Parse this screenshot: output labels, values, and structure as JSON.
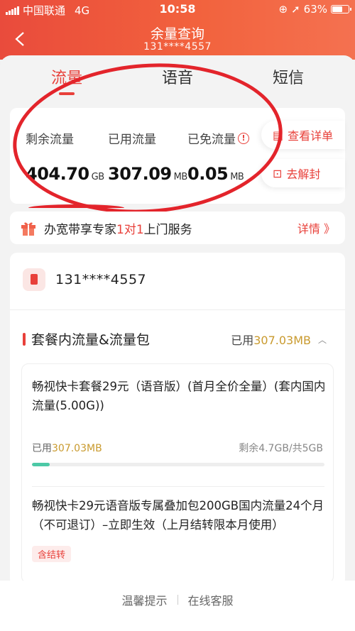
{
  "status_bar": {
    "carrier": "中国联通",
    "network": "4G",
    "time": "10:58",
    "battery_percent": "63%"
  },
  "header": {
    "title": "余量查询",
    "phone": "131****4557"
  },
  "tabs": [
    {
      "label": "流量",
      "active": true
    },
    {
      "label": "语音",
      "active": false
    },
    {
      "label": "短信",
      "active": false
    }
  ],
  "usage": {
    "remaining": {
      "label": "剩余流量",
      "value": "404.70",
      "unit": "GB"
    },
    "used": {
      "label": "已用流量",
      "value": "307.09",
      "unit": "MB"
    },
    "free": {
      "label": "已免流量",
      "value": "0.05",
      "unit": "MB"
    },
    "view_detail": "查看详单",
    "unblock": "去解封"
  },
  "promo": {
    "text_before": "办宽带享专家",
    "text_highlight": "1对1",
    "text_after": "上门服务",
    "more": "详情 》"
  },
  "detail": {
    "phone": "131****4557",
    "section_title": "套餐内流量&流量包",
    "section_used_label": "已用",
    "section_used_value": "307.03MB",
    "packages": [
      {
        "name": "畅视快卡套餐29元（语音版）(首月全价全量）(套内国内流量(5.00G))",
        "used_label": "已用",
        "used_value": "307.03MB",
        "remaining": "剩余4.7GB/共5GB",
        "progress_fraction": 0.06
      },
      {
        "name": "畅视快卡29元语音版专属叠加包200GB国内流量24个月（不可退订）–立即生效（上月结转限本月使用）",
        "tag": "含结转"
      }
    ]
  },
  "footer": {
    "tips": "温馨提示",
    "service": "在线客服"
  },
  "colors": {
    "accent": "#e8403a",
    "gold": "#c99a2e",
    "progress": "#4cc9a6"
  }
}
